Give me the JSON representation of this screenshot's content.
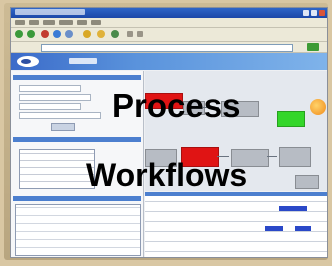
{
  "overlay": {
    "line1": "Process",
    "line2": "Workflows"
  },
  "icons": {
    "toolbar": [
      "back-icon",
      "forward-icon",
      "stop-icon",
      "refresh-icon",
      "home-icon",
      "search-icon",
      "favorites-icon",
      "history-icon",
      "mail-icon",
      "print-icon"
    ],
    "status": "status-orb-icon"
  },
  "colors": {
    "title_bar": "#1c47a8",
    "banner": "#5a93dc",
    "node_active": "#e01414",
    "node_complete": "#34d62a",
    "node_pending": "#b7bcc4",
    "status_orb": "#f08a1a",
    "overlay_text": "#000000"
  }
}
